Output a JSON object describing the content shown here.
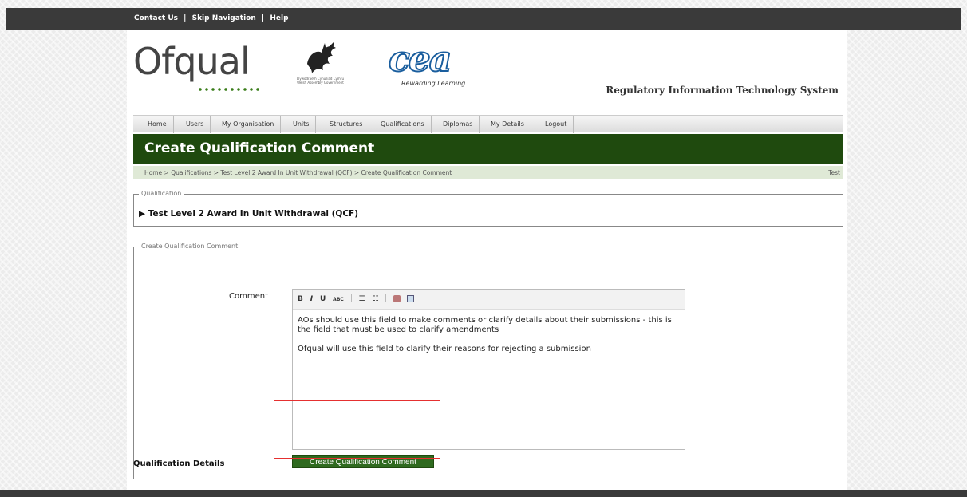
{
  "topbar": {
    "contact": "Contact Us",
    "sep": "|",
    "skip": "Skip Navigation",
    "help": "Help"
  },
  "header": {
    "ofqual_logo": "Ofqual",
    "wales_caption_1": "Llywodraeth Cynulliad Cymru",
    "wales_caption_2": "Welsh Assembly Government",
    "cea_logo": "cea",
    "cea_tagline": "Rewarding Learning",
    "system_title": "Regulatory Information Technology System"
  },
  "nav": {
    "items": [
      "Home",
      "Users",
      "My Organisation",
      "Units",
      "Structures",
      "Qualifications",
      "Diplomas",
      "My Details",
      "Logout"
    ]
  },
  "page": {
    "title": "Create Qualification Comment",
    "breadcrumb": "Home > Qualifications > Test Level 2 Award In Unit Withdrawal (QCF) > Create Qualification Comment",
    "breadcrumb_right": "Test"
  },
  "qualification_section": {
    "legend": "Qualification",
    "name": "▶ Test Level 2 Award In Unit Withdrawal (QCF)"
  },
  "comment_section": {
    "legend": "Create Qualification Comment",
    "label": "Comment",
    "toolbar": {
      "bold": "B",
      "italic": "I",
      "underline": "U",
      "strike": "ABC",
      "bullets": "☰",
      "numbered": "☷"
    },
    "paragraph_1": "AOs should use this field to make comments or clarify details about their submissions - this is the field that must be used to clarify amendments",
    "paragraph_2": "Ofqual will use this field to clarify their reasons for rejecting a submission",
    "button": "Create Qualification Comment"
  },
  "footer_link": "Qualification Details",
  "colors": {
    "brand_green": "#1f4a0e",
    "button_green": "#2f6a1f",
    "highlight_red": "#e53030"
  }
}
